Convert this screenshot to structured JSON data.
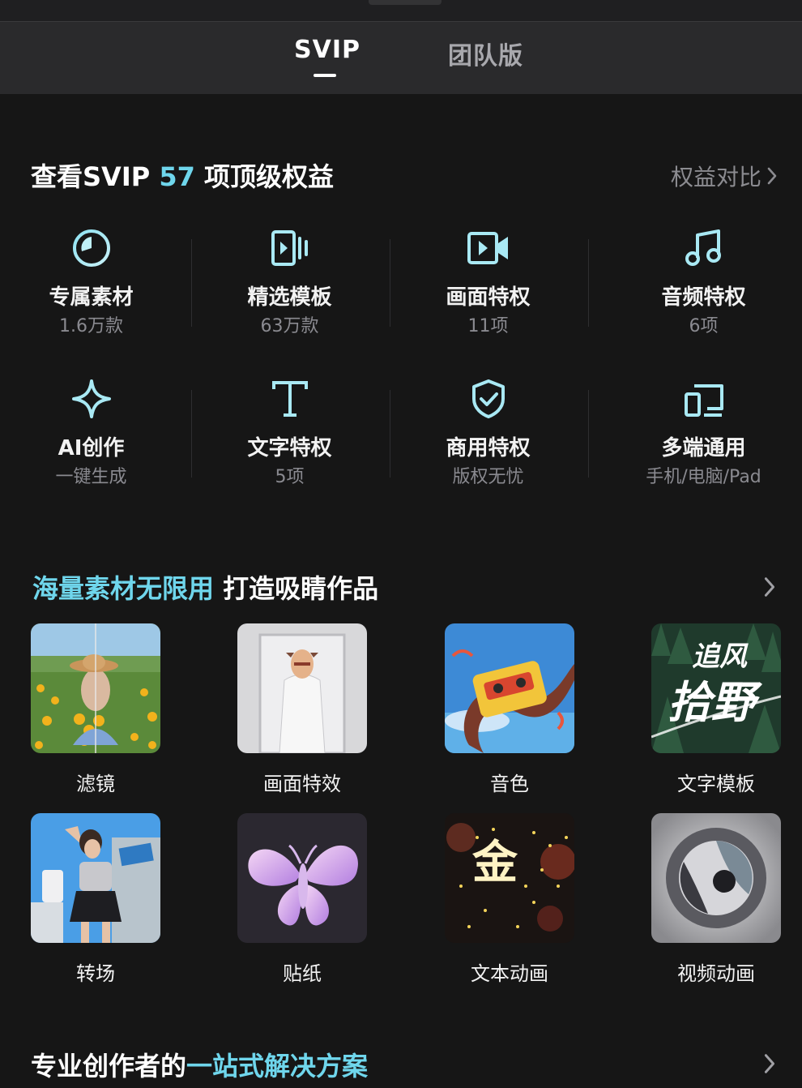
{
  "tabs": [
    {
      "label": "SVIP",
      "active": true
    },
    {
      "label": "团队版",
      "active": false
    }
  ],
  "benefits_section": {
    "title_prefix": "查看SVIP ",
    "title_count": "57",
    "title_suffix": " 项顶级权益",
    "compare_label": "权益对比"
  },
  "benefits": [
    {
      "icon": "clock-disc-icon",
      "title": "专属素材",
      "sub": "1.6万款"
    },
    {
      "icon": "template-film-icon",
      "title": "精选模板",
      "sub": "63万款"
    },
    {
      "icon": "video-camera-icon",
      "title": "画面特权",
      "sub": "11项"
    },
    {
      "icon": "music-note-icon",
      "title": "音频特权",
      "sub": "6项"
    },
    {
      "icon": "sparkle-icon",
      "title": "AI创作",
      "sub": "一键生成"
    },
    {
      "icon": "text-t-icon",
      "title": "文字特权",
      "sub": "5项"
    },
    {
      "icon": "shield-check-icon",
      "title": "商用特权",
      "sub": "版权无忧"
    },
    {
      "icon": "multi-device-icon",
      "title": "多端通用",
      "sub": "手机/电脑/Pad"
    }
  ],
  "materials_section": {
    "title_accent": "海量素材无限用",
    "title_rest": " 打造吸睛作品"
  },
  "materials": [
    {
      "label": "滤镜",
      "thumb": "filter-photo"
    },
    {
      "label": "画面特效",
      "thumb": "effect-photo"
    },
    {
      "label": "音色",
      "thumb": "cassette-illustration"
    },
    {
      "label": "文字模板",
      "thumb": "text-template-photo",
      "thumb_text_1": "追风",
      "thumb_text_2": "拾野"
    },
    {
      "label": "转场",
      "thumb": "transition-photo"
    },
    {
      "label": "贴纸",
      "thumb": "butterfly-sticker"
    },
    {
      "label": "文本动画",
      "thumb": "text-animation-photo",
      "thumb_text": "金"
    },
    {
      "label": "视频动画",
      "thumb": "video-animation-photo"
    }
  ],
  "solution_section": {
    "title_rest": "专业创作者的",
    "title_accent": "一站式解决方案"
  },
  "colors": {
    "accent": "#6fd6ec",
    "background": "#161616",
    "header": "#2a2a2c",
    "muted": "#8a8a90"
  }
}
